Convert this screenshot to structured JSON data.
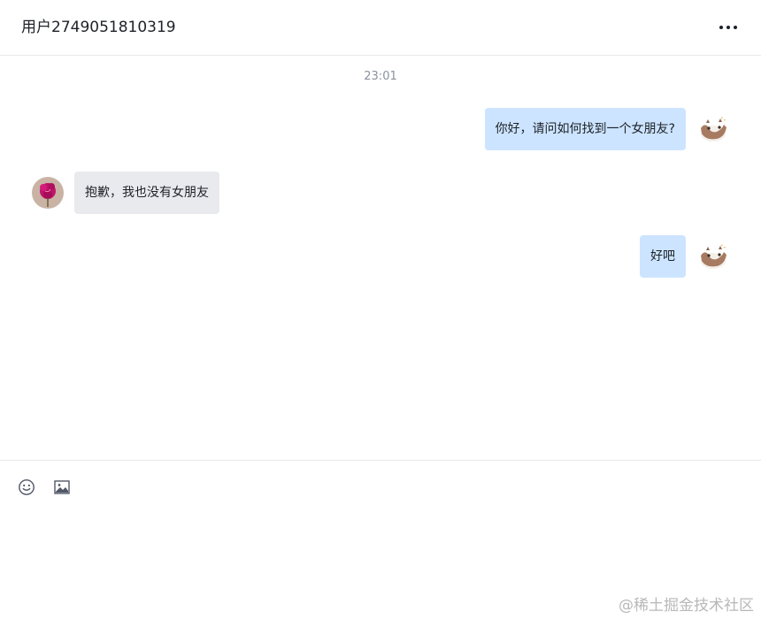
{
  "header": {
    "title": "用户2749051810319",
    "more_icon": "more-horizontal-icon"
  },
  "conversation": {
    "timestamp": "23:01",
    "messages": [
      {
        "sender": "me",
        "text": "你好，请问如何找到一个女朋友?"
      },
      {
        "sender": "other",
        "text": "抱歉，我也没有女朋友"
      },
      {
        "sender": "me",
        "text": "好吧"
      }
    ]
  },
  "composer": {
    "tools": [
      "emoji-icon",
      "image-icon"
    ],
    "value": "",
    "placeholder": ""
  },
  "watermark": "@稀土掘金技术社区",
  "colors": {
    "my_bubble": "#cce4ff",
    "other_bubble": "#e9eaed",
    "divider": "#e8e8e8",
    "timestamp_text": "#8a919f"
  }
}
